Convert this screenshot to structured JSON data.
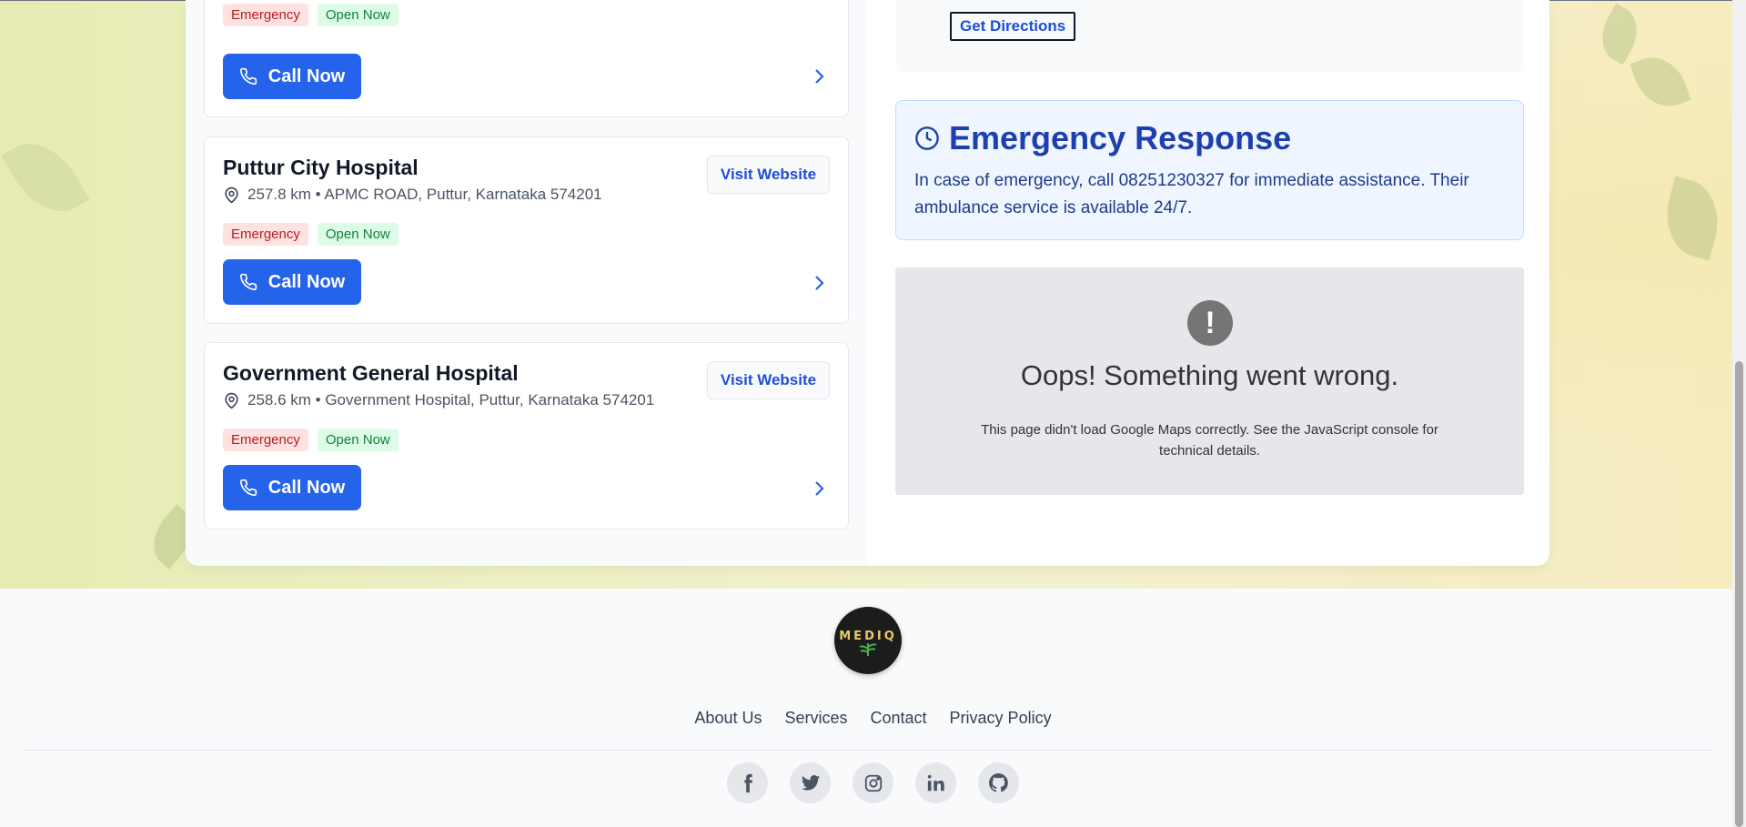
{
  "hospitals": [
    {
      "name": "",
      "address": "",
      "badges": {
        "emergency": "Emergency",
        "open": "Open Now"
      },
      "call_label": "Call Now"
    },
    {
      "name": "Puttur City Hospital",
      "address": "257.8 km • APMC ROAD, Puttur, Karnataka 574201",
      "badges": {
        "emergency": "Emergency",
        "open": "Open Now"
      },
      "call_label": "Call Now",
      "visit_label": "Visit Website"
    },
    {
      "name": "Government General Hospital",
      "address": "258.6 km • Government Hospital, Puttur, Karnataka 574201",
      "badges": {
        "emergency": "Emergency",
        "open": "Open Now"
      },
      "call_label": "Call Now",
      "visit_label": "Visit Website"
    }
  ],
  "details": {
    "directions_label": "Get Directions",
    "emergency_title": "Emergency Response",
    "emergency_text": "In case of emergency, call 08251230327 for immediate assistance. Their ambulance service is available 24/7."
  },
  "map_error": {
    "icon": "!",
    "title": "Oops! Something went wrong.",
    "message": "This page didn't load Google Maps correctly. See the JavaScript console for technical details."
  },
  "footer": {
    "logo_text": "MEDIQ",
    "links": [
      "About Us",
      "Services",
      "Contact",
      "Privacy Policy"
    ],
    "socials": [
      "facebook-icon",
      "twitter-icon",
      "instagram-icon",
      "linkedin-icon",
      "github-icon"
    ]
  },
  "colors": {
    "primary": "#2563eb",
    "emergency_bg": "#fee2e2",
    "open_bg": "#dcfce7",
    "info_bg": "#eff6ff"
  }
}
